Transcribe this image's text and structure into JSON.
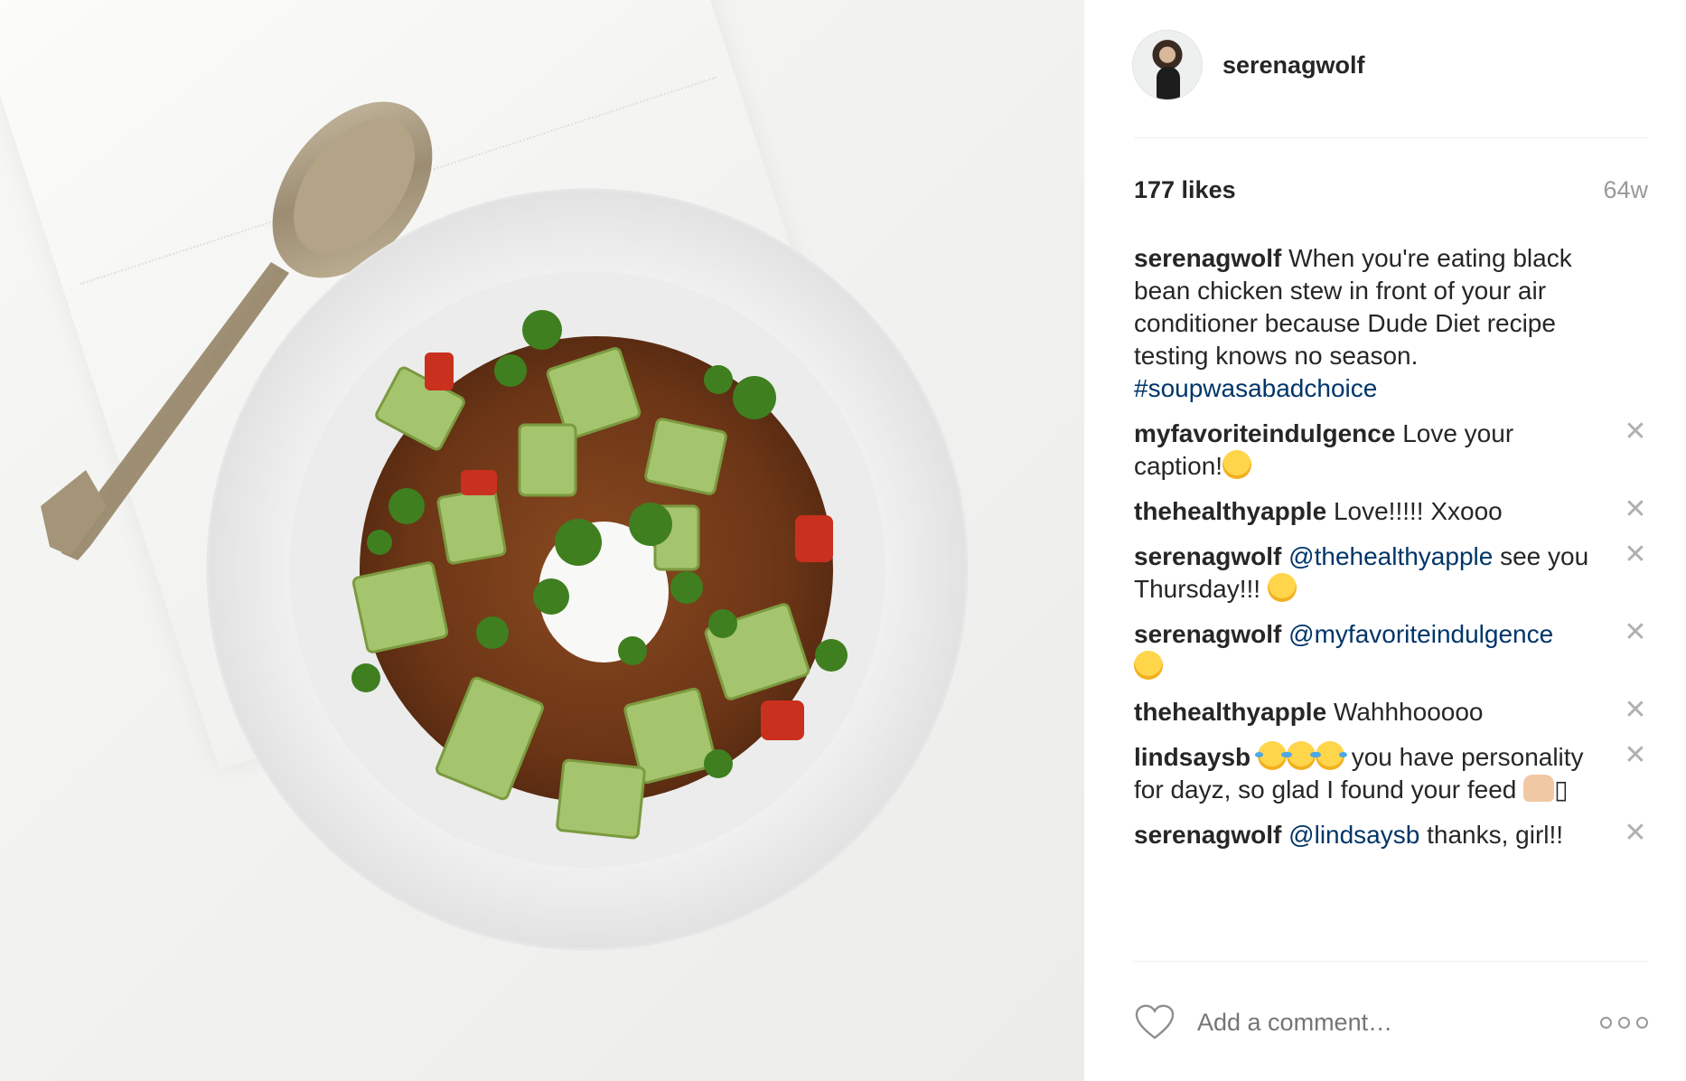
{
  "post": {
    "username": "serenagwolf",
    "likes": "177 likes",
    "age": "64w",
    "caption": {
      "user": "serenagwolf",
      "text": "When you're eating black bean chicken stew in front of your air conditioner because Dude Diet recipe testing knows no season.",
      "hashtag": "#soupwasabadchoice"
    },
    "comments": [
      {
        "user": "myfavoriteindulgence",
        "text": "Love your caption!"
      },
      {
        "user": "thehealthyapple",
        "text": "Love!!!!! Xxooo"
      },
      {
        "user": "serenagwolf",
        "mention": "@thehealthyapple",
        "text": "see you Thursday!!!"
      },
      {
        "user": "serenagwolf",
        "mention": "@myfavoriteindulgence",
        "text": ""
      },
      {
        "user": "thehealthyapple",
        "text": "Wahhhooooo"
      },
      {
        "user": "lindsaysb",
        "text": "you have personality for dayz, so glad I found your feed",
        "tail": "▯"
      },
      {
        "user": "serenagwolf",
        "mention": "@lindsaysb",
        "text": "thanks, girl!!"
      }
    ],
    "close_glyph": "✕",
    "add_comment_placeholder": "Add a comment…",
    "icons": {
      "like": "heart-icon",
      "more": "more-options-icon",
      "remove": "close-icon"
    },
    "colors": {
      "link": "#003569",
      "muted": "#999999",
      "text": "#262626"
    }
  }
}
